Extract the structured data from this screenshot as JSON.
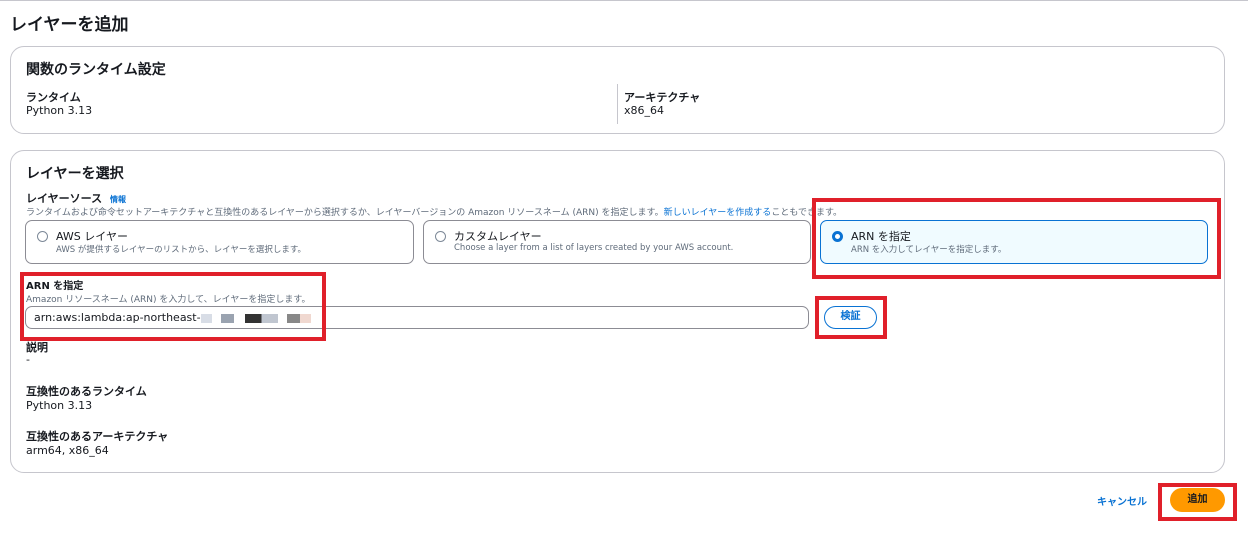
{
  "page": {
    "title": "レイヤーを追加"
  },
  "runtime_settings": {
    "heading": "関数のランタイム設定",
    "runtime_label": "ランタイム",
    "runtime_value": "Python 3.13",
    "architecture_label": "アーキテクチャ",
    "architecture_value": "x86_64"
  },
  "select_layer": {
    "heading": "レイヤーを選択",
    "source_label": "レイヤーソース",
    "info_link": "情報",
    "source_desc": "ランタイムおよび命令セットアーキテクチャと互換性のあるレイヤーから選択するか、レイヤーバージョンの Amazon リソースネーム (ARN) を指定します。",
    "create_link": "新しいレイヤーを作成する",
    "source_desc_tail": "こともできます。",
    "options": [
      {
        "title": "AWS レイヤー",
        "desc": "AWS が提供するレイヤーのリストから、レイヤーを選択します。",
        "selected": false
      },
      {
        "title": "カスタムレイヤー",
        "desc": "Choose a layer from a list of layers created by your AWS account.",
        "selected": false
      },
      {
        "title": "ARN を指定",
        "desc": "ARN を入力してレイヤーを指定します。",
        "selected": true
      }
    ],
    "arn_label": "ARN を指定",
    "arn_desc": "Amazon リソースネーム (ARN) を入力して、レイヤーを指定します。",
    "arn_value": "arn:aws:lambda:ap-northeast-",
    "verify_button": "検証",
    "description_label": "説明",
    "description_value": "-",
    "compat_runtime_label": "互換性のあるランタイム",
    "compat_runtime_value": "Python 3.13",
    "compat_arch_label": "互換性のあるアーキテクチャ",
    "compat_arch_value": "arm64, x86_64"
  },
  "footer": {
    "cancel": "キャンセル",
    "add": "追加"
  },
  "colors": {
    "accent": "#0972d3",
    "primary": "#ff9900",
    "highlight": "#e0202a"
  }
}
